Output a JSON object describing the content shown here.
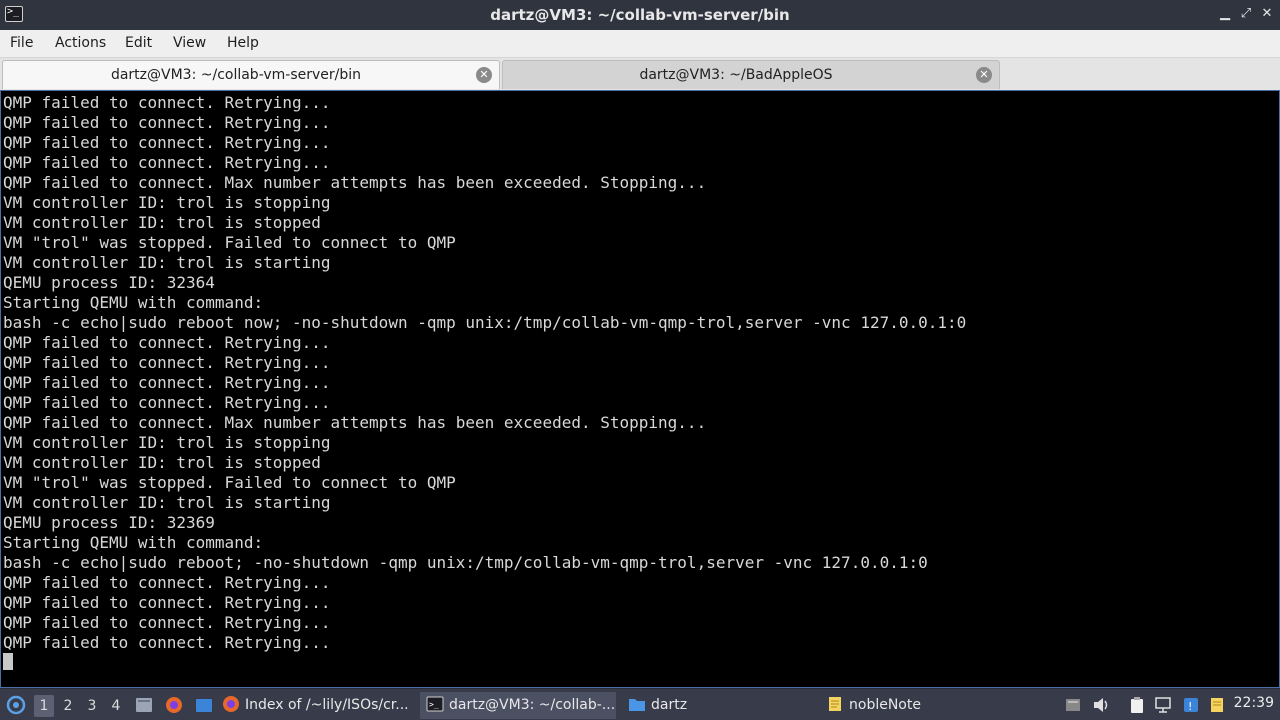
{
  "window": {
    "title": "dartz@VM3: ~/collab-vm-server/bin",
    "minimize": "▁",
    "maximize": "⤢",
    "close": "✕"
  },
  "menu": [
    "File",
    "Actions",
    "Edit",
    "View",
    "Help"
  ],
  "tabs": [
    {
      "label": "dartz@VM3: ~/collab-vm-server/bin",
      "active": true
    },
    {
      "label": "dartz@VM3: ~/BadAppleOS",
      "active": false
    }
  ],
  "terminal_lines": [
    "QMP failed to connect. Retrying...",
    "QMP failed to connect. Retrying...",
    "QMP failed to connect. Retrying...",
    "QMP failed to connect. Retrying...",
    "QMP failed to connect. Max number attempts has been exceeded. Stopping...",
    "VM controller ID: trol is stopping",
    "VM controller ID: trol is stopped",
    "VM \"trol\" was stopped. Failed to connect to QMP",
    "VM controller ID: trol is starting",
    "QEMU process ID: 32364",
    "Starting QEMU with command:",
    "bash -c echo|sudo reboot now; -no-shutdown -qmp unix:/tmp/collab-vm-qmp-trol,server -vnc 127.0.0.1:0",
    "QMP failed to connect. Retrying...",
    "QMP failed to connect. Retrying...",
    "QMP failed to connect. Retrying...",
    "QMP failed to connect. Retrying...",
    "QMP failed to connect. Max number attempts has been exceeded. Stopping...",
    "VM controller ID: trol is stopping",
    "VM controller ID: trol is stopped",
    "VM \"trol\" was stopped. Failed to connect to QMP",
    "VM controller ID: trol is starting",
    "QEMU process ID: 32369",
    "Starting QEMU with command:",
    "bash -c echo|sudo reboot; -no-shutdown -qmp unix:/tmp/collab-vm-qmp-trol,server -vnc 127.0.0.1:0",
    "QMP failed to connect. Retrying...",
    "QMP failed to connect. Retrying...",
    "QMP failed to connect. Retrying...",
    "QMP failed to connect. Retrying..."
  ],
  "taskbar": {
    "workspaces": [
      "1",
      "2",
      "3",
      "4"
    ],
    "active_workspace": "1",
    "tasks": [
      {
        "label": "Index of /~lily/ISOs/cr...",
        "icon": "firefox-icon",
        "active": false
      },
      {
        "label": "dartz@VM3: ~/collab-...",
        "icon": "terminal-icon",
        "active": true
      },
      {
        "label": "dartz",
        "icon": "folder-icon",
        "active": false
      },
      {
        "label": "nobleNote",
        "icon": "note-icon",
        "active": false
      }
    ],
    "clock": "22:39"
  },
  "colors": {
    "terminal_bg": "#000000",
    "terminal_fg": "#d8d8d8",
    "titlebar_bg": "#2f343f",
    "taskbar_bg": "#383c4a"
  }
}
